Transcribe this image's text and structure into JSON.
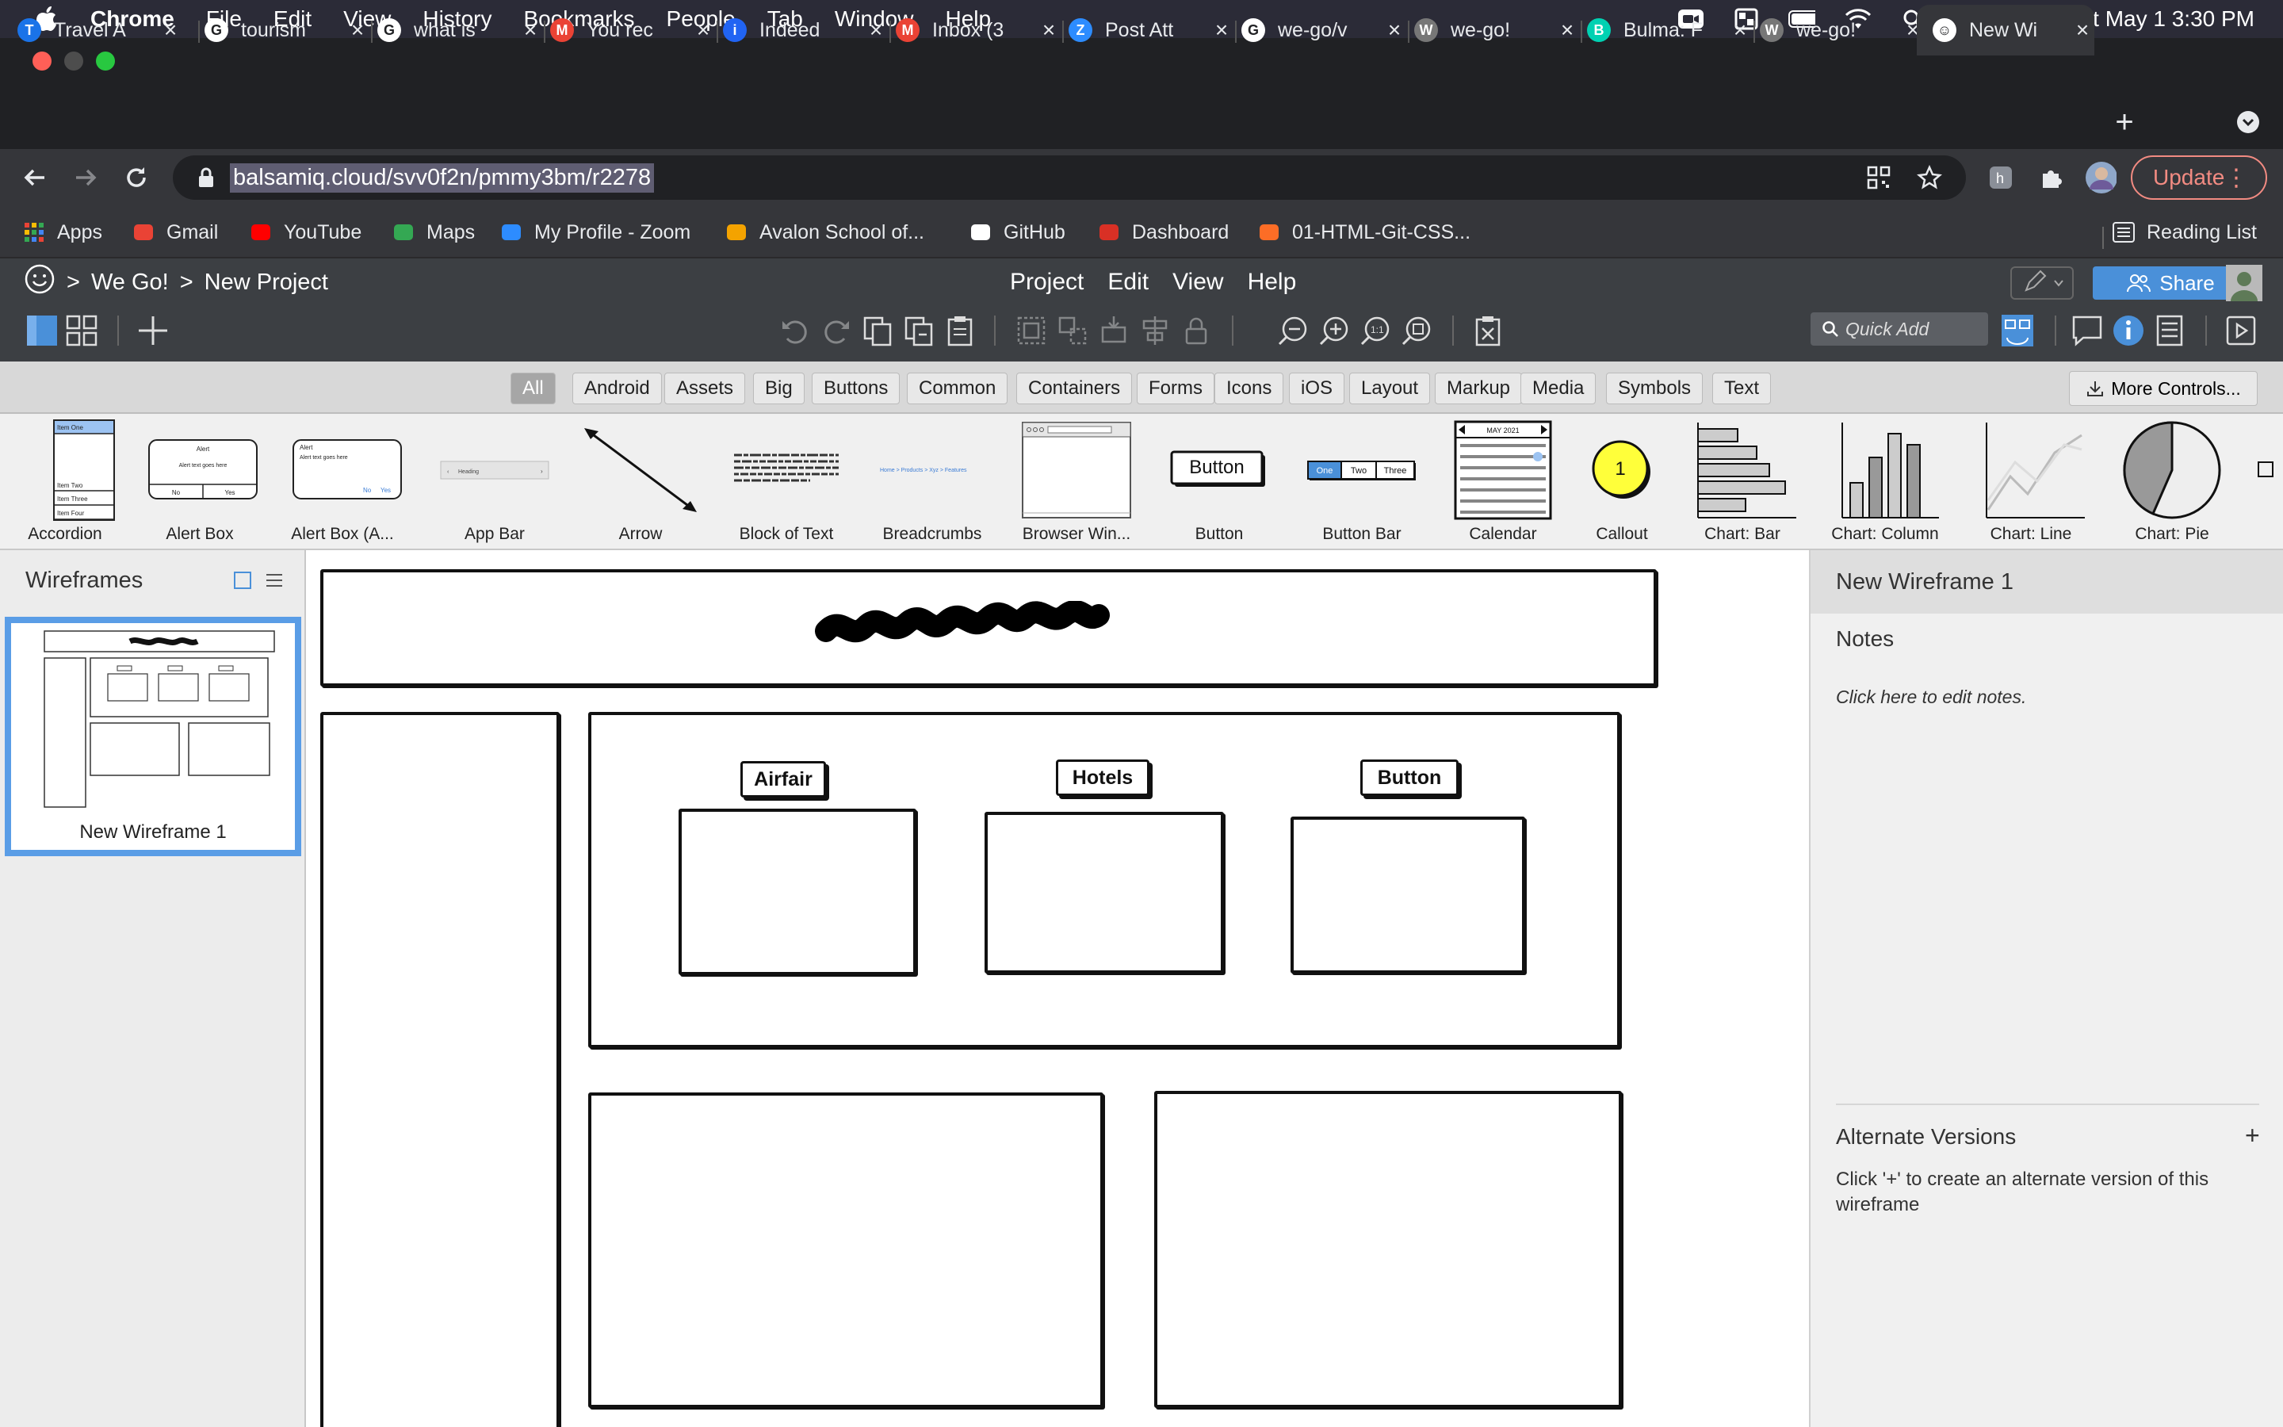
{
  "menubar": {
    "app_name": "Chrome",
    "items": [
      "File",
      "Edit",
      "View",
      "History",
      "Bookmarks",
      "People",
      "Tab",
      "Window",
      "Help"
    ],
    "clock": "Sat May 1  3:30 PM"
  },
  "tabs": [
    {
      "title": "Travel A",
      "color": "#1a73e8",
      "glyph": "T"
    },
    {
      "title": "tourism",
      "color": "#ffffff",
      "glyph": "G"
    },
    {
      "title": "what is",
      "color": "#ffffff",
      "glyph": "G"
    },
    {
      "title": "You rec",
      "color": "#ea4335",
      "glyph": "M"
    },
    {
      "title": "Indeed",
      "color": "#2164f3",
      "glyph": "i"
    },
    {
      "title": "Inbox (3",
      "color": "#ea4335",
      "glyph": "M"
    },
    {
      "title": "Post Att",
      "color": "#2d8cff",
      "glyph": "Z"
    },
    {
      "title": "we-go/v",
      "color": "#ffffff",
      "glyph": "G"
    },
    {
      "title": "we-go!",
      "color": "#777777",
      "glyph": "W"
    },
    {
      "title": "Bulma: F",
      "color": "#00d1b2",
      "glyph": "B"
    },
    {
      "title": "we-go!",
      "color": "#777777",
      "glyph": "W"
    },
    {
      "title": "New Wi",
      "color": "#ffffff",
      "glyph": "☺"
    }
  ],
  "toolbar": {
    "url": "balsamiq.cloud/svv0f2n/pmmy3bm/r2278",
    "update_label": "Update"
  },
  "bookmarks": [
    {
      "label": "Apps",
      "color": "#4285f4"
    },
    {
      "label": "Gmail",
      "color": "#ea4335"
    },
    {
      "label": "YouTube",
      "color": "#ff0000"
    },
    {
      "label": "Maps",
      "color": "#34a853"
    },
    {
      "label": "My Profile - Zoom",
      "color": "#2d8cff"
    },
    {
      "label": "Avalon School of...",
      "color": "#f4a300"
    },
    {
      "label": "GitHub",
      "color": "#ffffff"
    },
    {
      "label": "Dashboard",
      "color": "#d93025"
    },
    {
      "label": "01-HTML-Git-CSS...",
      "color": "#fc6d26"
    }
  ],
  "reading_list": "Reading List",
  "balsamiq": {
    "breadcrumb": {
      "sep": ">",
      "project": "We Go!",
      "page": "New Project"
    },
    "menu": [
      "Project",
      "Edit",
      "View",
      "Help"
    ],
    "share_label": "Share",
    "quick_add_placeholder": "Quick Add"
  },
  "library": {
    "filters": [
      "All",
      "Android",
      "Assets",
      "Big",
      "Buttons",
      "Common",
      "Containers",
      "Forms",
      "Icons",
      "iOS",
      "Layout",
      "Markup",
      "Media",
      "Symbols",
      "Text"
    ],
    "active_filter": "All",
    "more_controls": "More Controls...",
    "items": [
      "Accordion",
      "Alert Box",
      "Alert Box (A...",
      "App Bar",
      "Arrow",
      "Block of Text",
      "Breadcrumbs",
      "Browser Win...",
      "Button",
      "Button Bar",
      "Calendar",
      "Callout",
      "Chart: Bar",
      "Chart: Column",
      "Chart: Line",
      "Chart: Pie"
    ],
    "thumb_text": {
      "accordion": [
        "Item One",
        "Item Two",
        "Item Three",
        "Item Four"
      ],
      "alert_title": "Alert",
      "alert_text": "Alert text goes here",
      "alert_no": "No",
      "alert_yes": "Yes",
      "app_bar": "Heading",
      "breadcrumbs": "Home > Products > Xyz > Features",
      "button": "Button",
      "button_bar": [
        "One",
        "Two",
        "Three"
      ],
      "calendar_month": "MAY 2021",
      "callout": "1"
    }
  },
  "wireframes_panel": {
    "title": "Wireframes",
    "items": [
      {
        "name": "New Wireframe 1"
      }
    ]
  },
  "canvas": {
    "buttons": [
      "Airfair",
      "Hotels",
      "Button"
    ]
  },
  "right_panel": {
    "title": "New Wireframe 1",
    "notes_heading": "Notes",
    "notes_placeholder": "Click here to edit notes.",
    "alt_heading": "Alternate Versions",
    "alt_add": "+",
    "alt_desc": "Click '+' to create an alternate version of this wireframe"
  }
}
